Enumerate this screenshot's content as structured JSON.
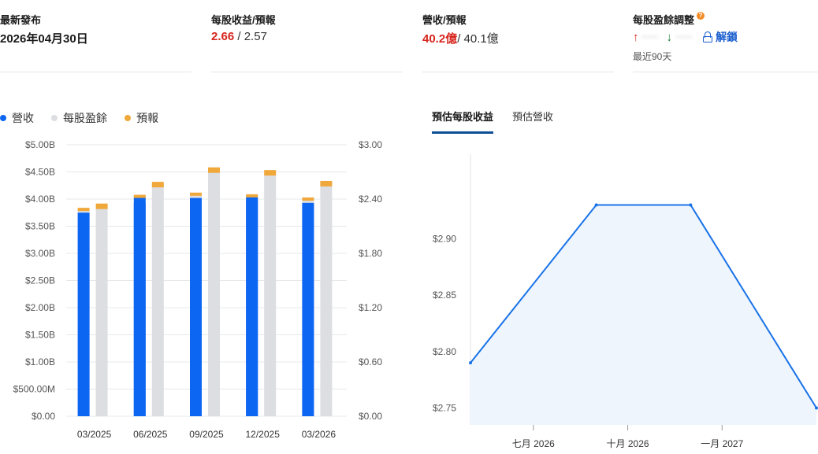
{
  "stats": {
    "release": {
      "label": "最新發布",
      "value": "2026年04月30日"
    },
    "eps": {
      "label": "每股收益/預報",
      "actual": "2.66",
      "sep": " / ",
      "forecast": "2.57"
    },
    "revenue": {
      "label": "營收/預報",
      "actual": "40.2億",
      "sep": "/ ",
      "forecast": "40.1億"
    },
    "revisions": {
      "label": "每股盈餘調整",
      "info_icon": "info-icon",
      "up_icon": "arrow-up-icon",
      "down_icon": "arrow-down-icon",
      "unlock_label": "解鎖",
      "period": "最近90天"
    }
  },
  "legend": [
    {
      "label": "營收",
      "color": "#0d66f2"
    },
    {
      "label": "每股盈餘",
      "color": "#dcdee1"
    },
    {
      "label": "預報",
      "color": "#f0a83a"
    }
  ],
  "tabs": [
    {
      "label": "預估每股收益",
      "active": true
    },
    {
      "label": "預估營收",
      "active": false
    }
  ],
  "colors": {
    "revenue": "#0d66f2",
    "eps": "#dcdee1",
    "forecast": "#f0a83a",
    "line": "#1a73e8",
    "area": "#eef5fd"
  },
  "chart_data": [
    {
      "type": "bar",
      "categories": [
        "03/2025",
        "06/2025",
        "09/2025",
        "12/2025",
        "03/2026"
      ],
      "y_left": {
        "ticks": [
          "$0.00",
          "$500.00M",
          "$1.00B",
          "$1.50B",
          "$2.00B",
          "$2.50B",
          "$3.00B",
          "$3.50B",
          "$4.00B",
          "$4.50B",
          "$5.00B"
        ],
        "min": 0,
        "max": 5000000000
      },
      "y_right": {
        "ticks": [
          "$0.00",
          "$0.60",
          "$1.20",
          "$1.80",
          "$2.40",
          "$3.00"
        ],
        "min": 0,
        "max": 3.0
      },
      "series": [
        {
          "name": "營收",
          "axis": "left",
          "actual": [
            3750000000,
            3930000000,
            4020000000,
            3990000000,
            3930000000
          ],
          "forecast": [
            3810000000,
            4050000000,
            4090000000,
            4060000000,
            4000000000
          ],
          "beat": [
            false,
            true,
            false,
            true,
            false
          ]
        },
        {
          "name": "每股盈餘",
          "axis": "right",
          "actual": [
            2.26,
            2.47,
            2.65,
            2.62,
            2.5
          ],
          "forecast": [
            2.32,
            2.56,
            2.72,
            2.69,
            2.57
          ],
          "beat": [
            false,
            false,
            true,
            false,
            true
          ]
        }
      ],
      "legend_position": "top-left",
      "grid": true
    },
    {
      "type": "area",
      "x": [
        "2026-05",
        "2026-09",
        "2026-12",
        "2027-04"
      ],
      "y": [
        2.79,
        2.93,
        2.93,
        2.75
      ],
      "x_ticks": [
        "七月 2026",
        "十月 2026",
        "一月 2027"
      ],
      "y_ticks": [
        "$2.75",
        "$2.80",
        "$2.85",
        "$2.90"
      ],
      "ylim": [
        2.735,
        2.975
      ],
      "grid": false
    }
  ]
}
